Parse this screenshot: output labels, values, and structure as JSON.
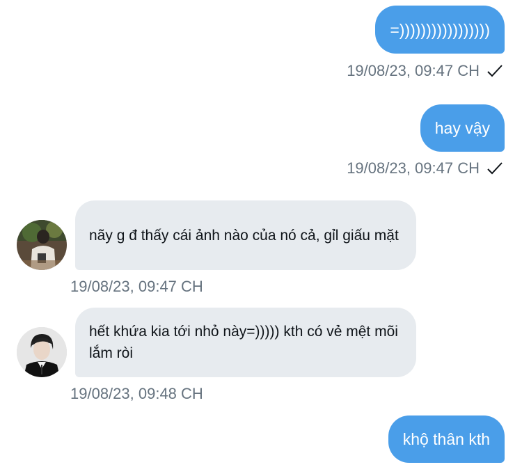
{
  "messages": [
    {
      "direction": "out",
      "text": "=)))))))))))))))))",
      "time": "19/08/23, 09:47 CH",
      "read_icon": "check-icon"
    },
    {
      "direction": "out",
      "text": "hay vậy",
      "time": "19/08/23, 09:47 CH",
      "read_icon": "check-icon"
    },
    {
      "direction": "in",
      "text": "nãy g đ thấy cái ảnh nào của nó cả, gỉl giấu mặt",
      "time": "19/08/23, 09:47 CH",
      "avatar": "avatar-photo"
    },
    {
      "direction": "in",
      "text": "hết khứa kia tới nhỏ này=))))) kth có vẻ mệt mõi lắm ròi",
      "time": "19/08/23, 09:48 CH",
      "avatar": "avatar-photo"
    },
    {
      "direction": "out",
      "text": "khộ thân kth"
    }
  ],
  "colors": {
    "outgoing_bubble": "#4a9ee9",
    "incoming_bubble": "#e7ebef",
    "timestamp": "#66737f"
  }
}
